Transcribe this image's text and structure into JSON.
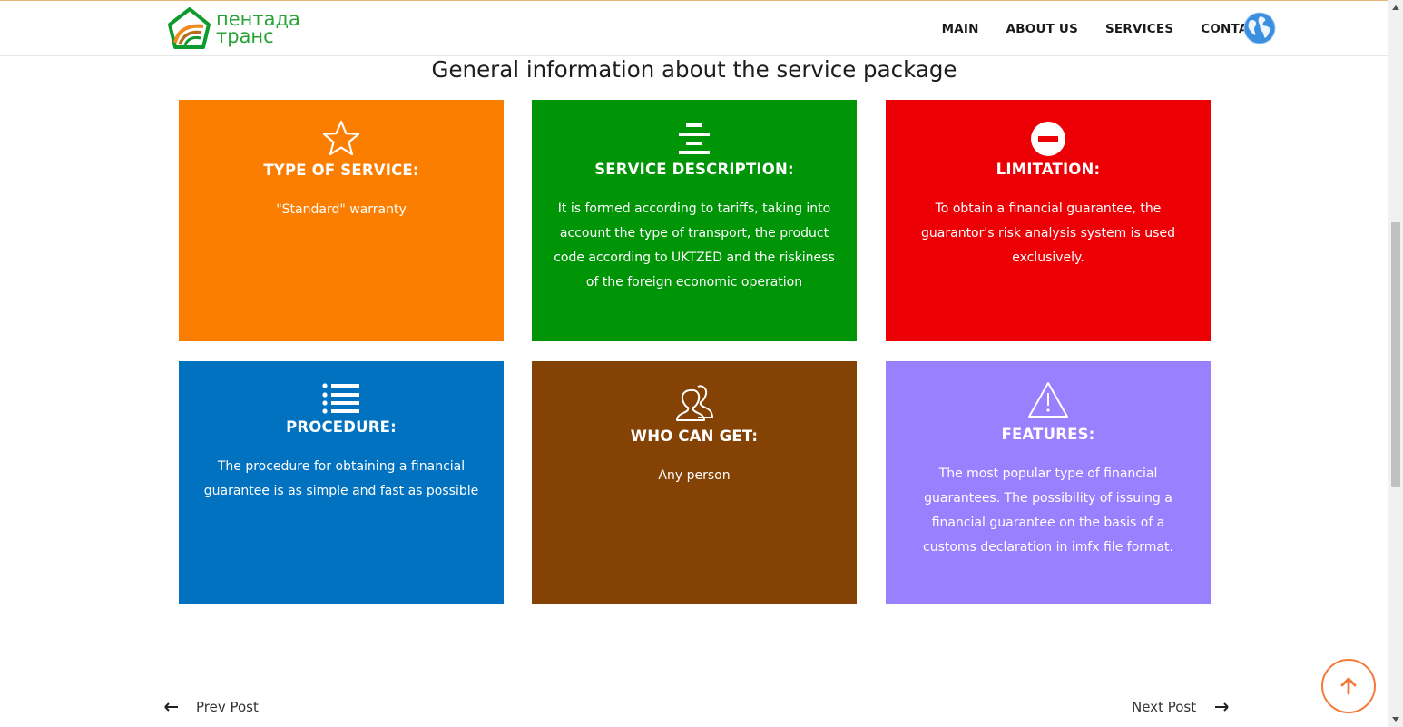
{
  "header": {
    "logo_line1": "пентада",
    "logo_line2": "транс",
    "nav": [
      "MAIN",
      "ABOUT US",
      "SERVICES",
      "CONTACTS"
    ]
  },
  "section": {
    "title": "General information about the service package"
  },
  "cards": [
    {
      "icon": "star-icon",
      "title": "TYPE OF SERVICE:",
      "text": "\"Standard\" warranty",
      "color": "#fb7e00"
    },
    {
      "icon": "align-center-icon",
      "title": "SERVICE DESCRIPTION:",
      "text": "It is formed according to tariffs, taking into account the type of transport, the product code according to UKTZED and the riskiness of the foreign economic operation",
      "color": "#009506"
    },
    {
      "icon": "no-entry-icon",
      "title": "LIMITATION:",
      "text": "To obtain a financial guarantee, the guarantor's risk analysis system is used exclusively.",
      "color": "#ec0006"
    },
    {
      "icon": "list-icon",
      "title": "PROCEDURE:",
      "text": "The procedure for obtaining a financial guarantee is as simple and fast as possible",
      "color": "#0072c0"
    },
    {
      "icon": "user-icon",
      "title": "WHO CAN GET:",
      "text": "Any person",
      "color": "#844204"
    },
    {
      "icon": "warning-icon",
      "title": "FEATURES:",
      "text": "The most popular type of financial guarantees. The possibility of issuing a financial guarantee on the basis of a customs declaration in imfx file format.",
      "color": "#9880ff"
    }
  ],
  "post_nav": {
    "prev": "Prev Post",
    "next": "Next Post"
  }
}
